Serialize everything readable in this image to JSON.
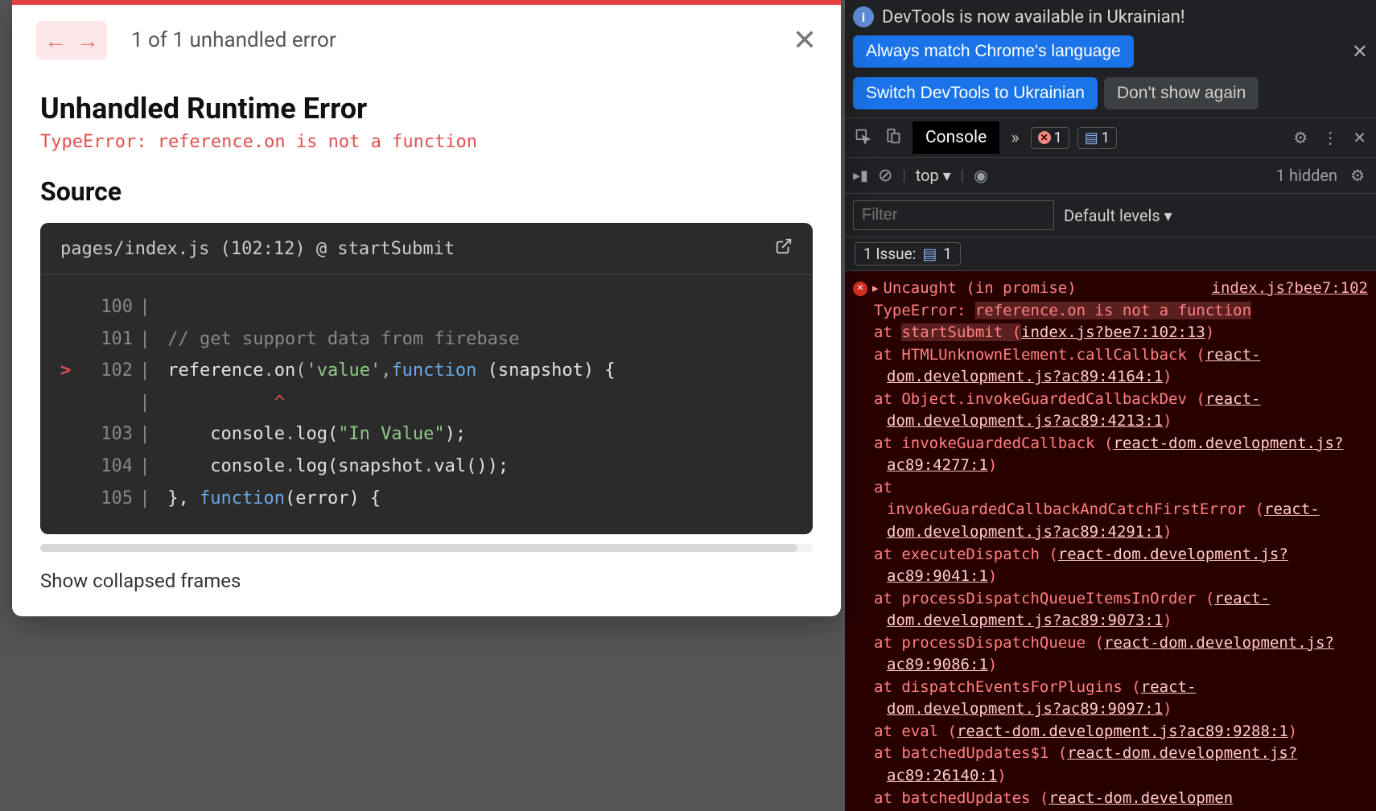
{
  "overlay": {
    "counter": "1 of 1 unhandled error",
    "title": "Unhandled Runtime Error",
    "message": "TypeError: reference.on is not a function",
    "source_heading": "Source",
    "location": "pages/index.js (102:12) @ startSubmit",
    "code": {
      "l100": {
        "num": "100",
        "content": ""
      },
      "l101": {
        "num": "101",
        "comment": "// get support data from firebase"
      },
      "l102": {
        "num": "102",
        "pre": "reference",
        "dot1": ".",
        "on": "on",
        "p1": "(",
        "str": "'value'",
        "comma": ",",
        "kw": "function",
        "rest": " (snapshot) {"
      },
      "caret": "^",
      "l103": {
        "num": "103",
        "pre": "    console",
        "dot": ".",
        "log": "log(",
        "str": "\"In Value\"",
        "end": ");"
      },
      "l104": {
        "num": "104",
        "pre": "    console",
        "dot": ".",
        "log": "log(snapshot",
        "dot2": ".",
        "val": "val());"
      },
      "l105": {
        "num": "105",
        "pre": "}, ",
        "kw": "function",
        "rest": "(error) {"
      }
    },
    "show_frames": "Show collapsed frames"
  },
  "devtools": {
    "banner_text": "DevTools is now available in Ukrainian!",
    "btn_match": "Always match Chrome's language",
    "btn_switch": "Switch DevTools to Ukrainian",
    "btn_dont": "Don't show again",
    "tab_console": "Console",
    "err_count": "1",
    "info_count": "1",
    "ctx": "top ▾",
    "hidden": "1 hidden",
    "filter_placeholder": "Filter",
    "levels": "Default levels ▾",
    "issue_label": "1 Issue:",
    "issue_count": "1",
    "console": {
      "l1a": "Uncaught (in promise)",
      "l1_src": "index.js?bee7:102",
      "l2": "TypeError: ",
      "l2b": "reference.on is not a function",
      "at": "at ",
      "s1a": "startSubmit (",
      "s1b": "index.js?bee7:102:13",
      "s1c": ")",
      "s2a": "HTMLUnknownElement.callCallback (",
      "s2b": "react-dom.development.js?ac89:4164:1",
      "s2c": ")",
      "s3a": "Object.invokeGuardedCallbackDev (",
      "s3b": "react-dom.development.js?ac89:4213:1",
      "s3c": ")",
      "s4a": "invokeGuardedCallback (",
      "s4b": "react-dom.development.js?ac89:4277:1",
      "s4c": ")",
      "s5a": "invokeGuardedCallbackAndCatchFirstError (",
      "s5b": "react-dom.development.js?ac89:4291:1",
      "s5c": ")",
      "s6a": "executeDispatch (",
      "s6b": "react-dom.development.js?ac89:9041:1",
      "s6c": ")",
      "s7a": "processDispatchQueueItemsInOrder (",
      "s7b": "react-dom.development.js?ac89:9073:1",
      "s7c": ")",
      "s8a": "processDispatchQueue (",
      "s8b": "react-dom.development.js?ac89:9086:1",
      "s8c": ")",
      "s9a": "dispatchEventsForPlugins (",
      "s9b": "react-dom.development.js?ac89:9097:1",
      "s9c": ")",
      "s10a": "eval (",
      "s10b": "react-dom.development.js?ac89:9288:1",
      "s10c": ")",
      "s11a": "batchedUpdates$1 (",
      "s11b": "react-dom.development.js?ac89:26140:1",
      "s11c": ")",
      "s12a": "batchedUpdates (",
      "s12b": "react-dom.developmen"
    }
  }
}
